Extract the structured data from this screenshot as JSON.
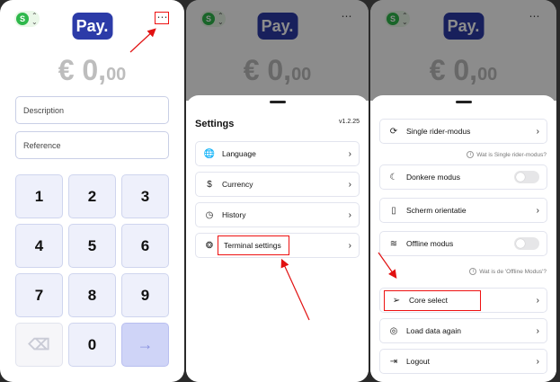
{
  "screen1": {
    "business_badge": "S",
    "logo": "Pay.",
    "more_icon": "⋯",
    "amount_main": "€ 0,",
    "amount_cents": "00",
    "description_placeholder": "Description",
    "reference_placeholder": "Reference",
    "keys": [
      "1",
      "2",
      "3",
      "4",
      "5",
      "6",
      "7",
      "8",
      "9",
      "",
      "0",
      ""
    ],
    "backspace_icon": "⌫",
    "confirm_icon": "→"
  },
  "screen2": {
    "business_badge": "S",
    "logo": "Pay.",
    "more_icon": "⋯",
    "amount_main": "€ 0,",
    "amount_cents": "00",
    "title": "Settings",
    "version": "v1.2.25",
    "items": [
      {
        "label": "Language",
        "icon": "🌐"
      },
      {
        "label": "Currency",
        "icon": "$"
      },
      {
        "label": "History",
        "icon": "◷"
      },
      {
        "label": "Terminal settings",
        "icon": "❂"
      }
    ],
    "chevron": "›"
  },
  "screen3": {
    "business_badge": "S",
    "logo": "Pay.",
    "more_icon": "⋯",
    "amount_main": "€ 0,",
    "amount_cents": "00",
    "single_rider": "Single rider-modus",
    "single_rider_hint": "Wat is Single rider-modus?",
    "dark_mode": "Donkere modus",
    "screen_orientation": "Scherm orientatie",
    "offline_mode": "Offline modus",
    "offline_hint": "Wat is de 'Offline Modus'?",
    "core_select": "Core select",
    "load_data": "Load data again",
    "logout": "Logout",
    "chevron": "›",
    "info_icon": "i"
  },
  "colors": {
    "brand": "#2c3ba8",
    "badge_green": "#2eb84b",
    "annotation_red": "#e11111",
    "key_bg": "#eef0fb"
  }
}
